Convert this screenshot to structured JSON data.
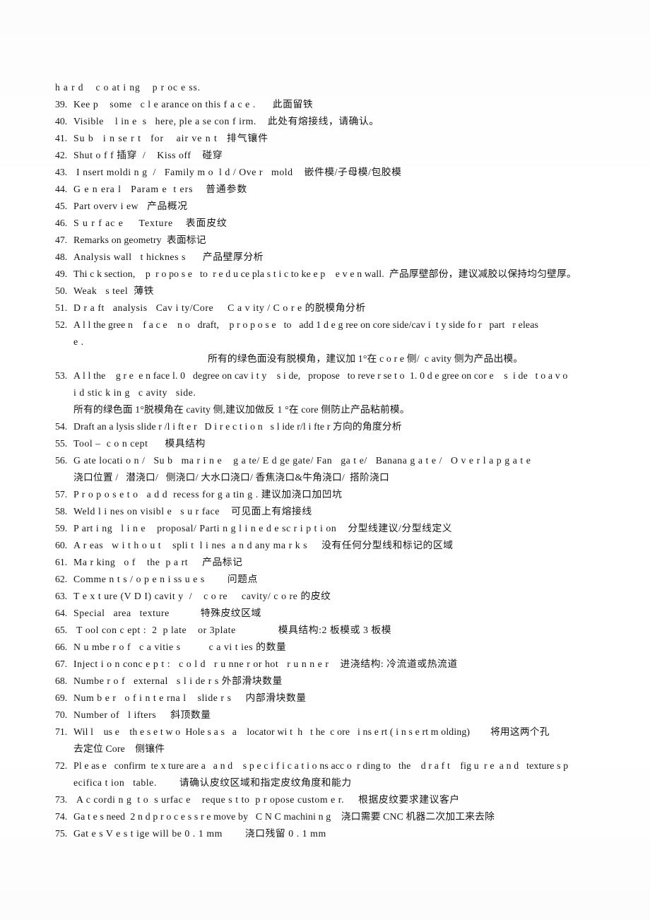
{
  "document": {
    "kind": "scanned-checklist-page",
    "language": "english-chinese-bilingual",
    "background_color": "#ffffff",
    "text_color": "#141414",
    "orphan_line": "h a r d    c o at i ng    p r oc e ss."
  },
  "items": [
    {
      "number": "39.",
      "lines": [
        {
          "text": "Kee p    some   c l e arance on this f a c e .      此面留铁",
          "track": "t2"
        }
      ]
    },
    {
      "number": "40.",
      "lines": [
        {
          "text": "Visible    l in e  s   here, ple a se con f irm.    此处有熔接线，请确认。",
          "track": "t2"
        }
      ]
    },
    {
      "number": "41.",
      "lines": [
        {
          "text": "Su b   i n se r t   for    air ve n t   排气镶件",
          "track": "t3"
        }
      ]
    },
    {
      "number": "42.",
      "lines": [
        {
          "text": "Shut o f f 插穿  /    Kiss off    碰穿",
          "track": "t2"
        }
      ]
    },
    {
      "number": "43.",
      "lines": [
        {
          "text": " I nsert moldi n g  /   Family m o  l d / Ove r   mold    嵌件模/子母模/包胶模",
          "track": "t2"
        }
      ]
    },
    {
      "number": "44.",
      "lines": [
        {
          "text": "G e n era l   Param e  t ers    普通参数",
          "track": "t3"
        }
      ]
    },
    {
      "number": "45.",
      "lines": [
        {
          "text": "Part overv i ew   产品概况",
          "track": "t2"
        }
      ]
    },
    {
      "number": "46.",
      "lines": [
        {
          "text": "S u r f ac e     Texture    表面皮纹",
          "track": "t3"
        }
      ]
    },
    {
      "number": "47.",
      "lines": [
        {
          "text": "Remarks on geometry  表面标记",
          "track": "t1"
        }
      ]
    },
    {
      "number": "48.",
      "lines": [
        {
          "text": "Analysis wall   t hicknes s      产品壁厚分析",
          "track": "t2"
        }
      ]
    },
    {
      "number": "49.",
      "lines": [
        {
          "text": "Thi c k section,    p  r o po s e   to  r e d u ce pla s t i c to ke e p    e v e n wall.  产品厚壁部份，建议减胶以保持均匀壁厚。",
          "track": "t1"
        }
      ]
    },
    {
      "number": "50.",
      "lines": [
        {
          "text": "Weak   s teel  薄铁",
          "track": "t2"
        }
      ]
    },
    {
      "number": "51.",
      "lines": [
        {
          "text": "D r a ft   analysis   Cav i ty/Core     C a v ity / C o r e 的脱模角分析",
          "track": "t2"
        }
      ]
    },
    {
      "number": "52.",
      "lines": [
        {
          "text": "A l l the gree n    f a c e    n o   draft,    p r o p o s e   to   add 1 d e g ree on core side/cav i  t y side fo r   part   r eleas",
          "track": "t1"
        },
        {
          "text": "e .",
          "track": "t2",
          "style": "ind0"
        },
        {
          "text": "所有的绿色面没有脱模角，建议加 1°在 c o r e 侧/  c avity 侧为产品出模。",
          "track": "t1",
          "style": "cn-ind"
        }
      ]
    },
    {
      "number": "53.",
      "lines": [
        {
          "text": "A l l the    g r e  e n face l. 0   degree on cav i t y    s i de,   propose   to reve r se t o  1. 0 d e gree on cor e    s  i de   t o a v o",
          "track": "t1"
        },
        {
          "text": "i d stic k in g   c avity   side.",
          "track": "t2"
        },
        {
          "text": "所有的绿色面 1°脱模角在 cavity 侧,建议加做反 1 °在 core 侧防止产品粘前模。",
          "track": "t1"
        }
      ]
    },
    {
      "number": "54.",
      "lines": [
        {
          "text": "Draft an a lysis slide r /l i ft e r   D i r e c t i o n   s l ide r/l i fte r 方向的角度分析",
          "track": "t1"
        }
      ]
    },
    {
      "number": "55.",
      "lines": [
        {
          "text": "Tool –  c o n cept      模具结构",
          "track": "t2"
        }
      ]
    },
    {
      "number": "56.",
      "lines": [
        {
          "text": "G ate locati o n /   Su b   ma r i n e    g a te/ E d ge gate/ Fan   ga t e/   Banana g a t e /   O v e r l a p g a t e",
          "track": "t2"
        },
        {
          "text": "浇口位置 /   潜浇口/   侧浇口/ 大水口浇口/ 香焦浇口&牛角浇口/  搭阶浇口",
          "track": "t1"
        }
      ]
    },
    {
      "number": "57.",
      "lines": [
        {
          "text": "P r o p o s e t o   a d d  recess for g a tin g . 建议加浇口加凹坑",
          "track": "t2"
        }
      ]
    },
    {
      "number": "58.",
      "lines": [
        {
          "text": "Weld l i nes on visibl e   s u r face    可见面上有熔接线",
          "track": "t2"
        }
      ]
    },
    {
      "number": "59.",
      "lines": [
        {
          "text": "P art i ng   l i n e    proposal/ Parti n g l i n e d e sc r i p t i on    分型线建议/分型线定义",
          "track": "t2"
        }
      ]
    },
    {
      "number": "60.",
      "lines": [
        {
          "text": "A r eas   w i t h o u t    spli t  l i nes  a n d any ma r k s     没有任何分型线和标记的区域",
          "track": "t2"
        }
      ]
    },
    {
      "number": "61.",
      "lines": [
        {
          "text": "Ma r king   o f    the  p a rt     产品标记",
          "track": "t2"
        }
      ]
    },
    {
      "number": "62.",
      "lines": [
        {
          "text": "Comme n t s / o p e n i ss u e s        问题点",
          "track": "t2"
        }
      ]
    },
    {
      "number": "63.",
      "lines": [
        {
          "text": "T e x t ure (V D I) cavit y  /    c o re     cavity/ c o re 的皮纹",
          "track": "t2"
        }
      ]
    },
    {
      "number": "64.",
      "lines": [
        {
          "text": "Special   area   texture           特殊皮纹区域",
          "track": "t2"
        }
      ]
    },
    {
      "number": "65.",
      "lines": [
        {
          "text": " T ool con c ept :  2  p late    or 3plate               模具结构:2 板模或 3 板模",
          "track": "t2"
        }
      ]
    },
    {
      "number": "66.",
      "lines": [
        {
          "text": "N u mbe r o f   c a vitie s          c a vi t ies 的数量",
          "track": "t2"
        }
      ]
    },
    {
      "number": "67.",
      "lines": [
        {
          "text": "Inject i o n conc e p t :   c o l d   r u nne r or hot   r u n n e r    进浇结构: 冷流道或热流道",
          "track": "t2"
        }
      ]
    },
    {
      "number": "68.",
      "lines": [
        {
          "text": "Numbe r o f   external   s l i de r s 外部滑块数量",
          "track": "t2"
        }
      ]
    },
    {
      "number": "69.",
      "lines": [
        {
          "text": "Num b e r   o f i n t e rna l    slide r s     内部滑块数量",
          "track": "t2"
        }
      ]
    },
    {
      "number": "70.",
      "lines": [
        {
          "text": "Number of   l ifters     斜顶数量",
          "track": "t2"
        }
      ]
    },
    {
      "number": "71.",
      "lines": [
        {
          "text": "Wil l    us e    th e s e t w o  Hole s a s   a    locator wi t  h   t he  c ore   i ns e rt ( i n s e rt m olding)        将用这两个孔",
          "track": "t1"
        },
        {
          "text": "去定位 Core    侧镶件",
          "track": "t1"
        }
      ]
    },
    {
      "number": "72.",
      "lines": [
        {
          "text": "Pl e as e   confirm  te x ture are a   a n d    s p e c i f i c a t i o ns acc o  r ding to   the    d r a f t    fig u  r e  a n d   texture s p",
          "track": "t1"
        },
        {
          "text": "ecifica t ion   table.        请确认皮纹区域和指定皮纹角度和能力",
          "track": "t2"
        }
      ]
    },
    {
      "number": "73.",
      "lines": [
        {
          "text": " A c cordi n g  t o  s urfac e    reque s t to  p r opose custom e r.     根据皮纹要求建议客户",
          "track": "t2"
        }
      ]
    },
    {
      "number": "74.",
      "lines": [
        {
          "text": "Ga t e s need  2 n d p r o c e s s r e move by   C N C machini n g    浇口需要 CNC 机器二次加工来去除",
          "track": "t1"
        }
      ]
    },
    {
      "number": "75.",
      "lines": [
        {
          "text": "Gat e s V e s t ige will be 0 . 1 mm        浇口残留 0 . 1 mm",
          "track": "t2"
        }
      ]
    }
  ]
}
